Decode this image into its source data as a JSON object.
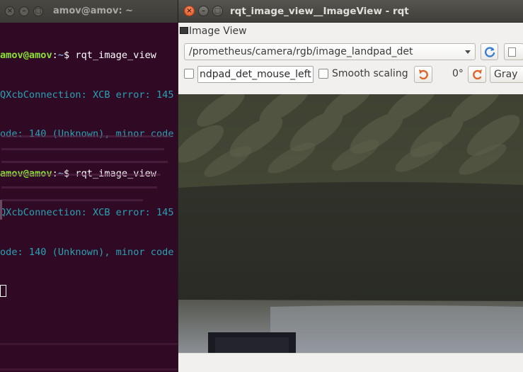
{
  "terminal": {
    "title": "amov@amov: ~",
    "lines": [
      {
        "kind": "prompt",
        "user": "amov@amov",
        "path": "~",
        "sym": "$",
        "cmd": " rqt_image_view"
      },
      {
        "kind": "error",
        "text": "QXcbConnection: XCB error: 145"
      },
      {
        "kind": "error",
        "text": "ode: 140 (Unknown), minor code"
      },
      {
        "kind": "prompt",
        "user": "amov@amov",
        "path": "~",
        "sym": "$",
        "cmd": " rqt_image_view"
      },
      {
        "kind": "error",
        "text": "QXcbConnection: XCB error: 145"
      },
      {
        "kind": "error",
        "text": "ode: 140 (Unknown), minor code"
      }
    ]
  },
  "rqt": {
    "title": "rqt_image_view__ImageView - rqt",
    "dock_title": "Image View",
    "topic": "/prometheus/camera/rgb/image_landpad_det",
    "mouse_topic_value": "ndpad_det_mouse_left",
    "smooth_scaling_label": "Smooth scaling",
    "rotation": "0°",
    "color_scheme": "Gray"
  },
  "colors": {
    "terminal_bg": "#300a24",
    "prompt_user": "#8ae234",
    "prompt_path": "#729fcf",
    "error_text": "#2aa1b3",
    "close_button": "#e2521d",
    "rotate_icon": "#e0632a",
    "refresh_icon": "#3b7fd0"
  }
}
